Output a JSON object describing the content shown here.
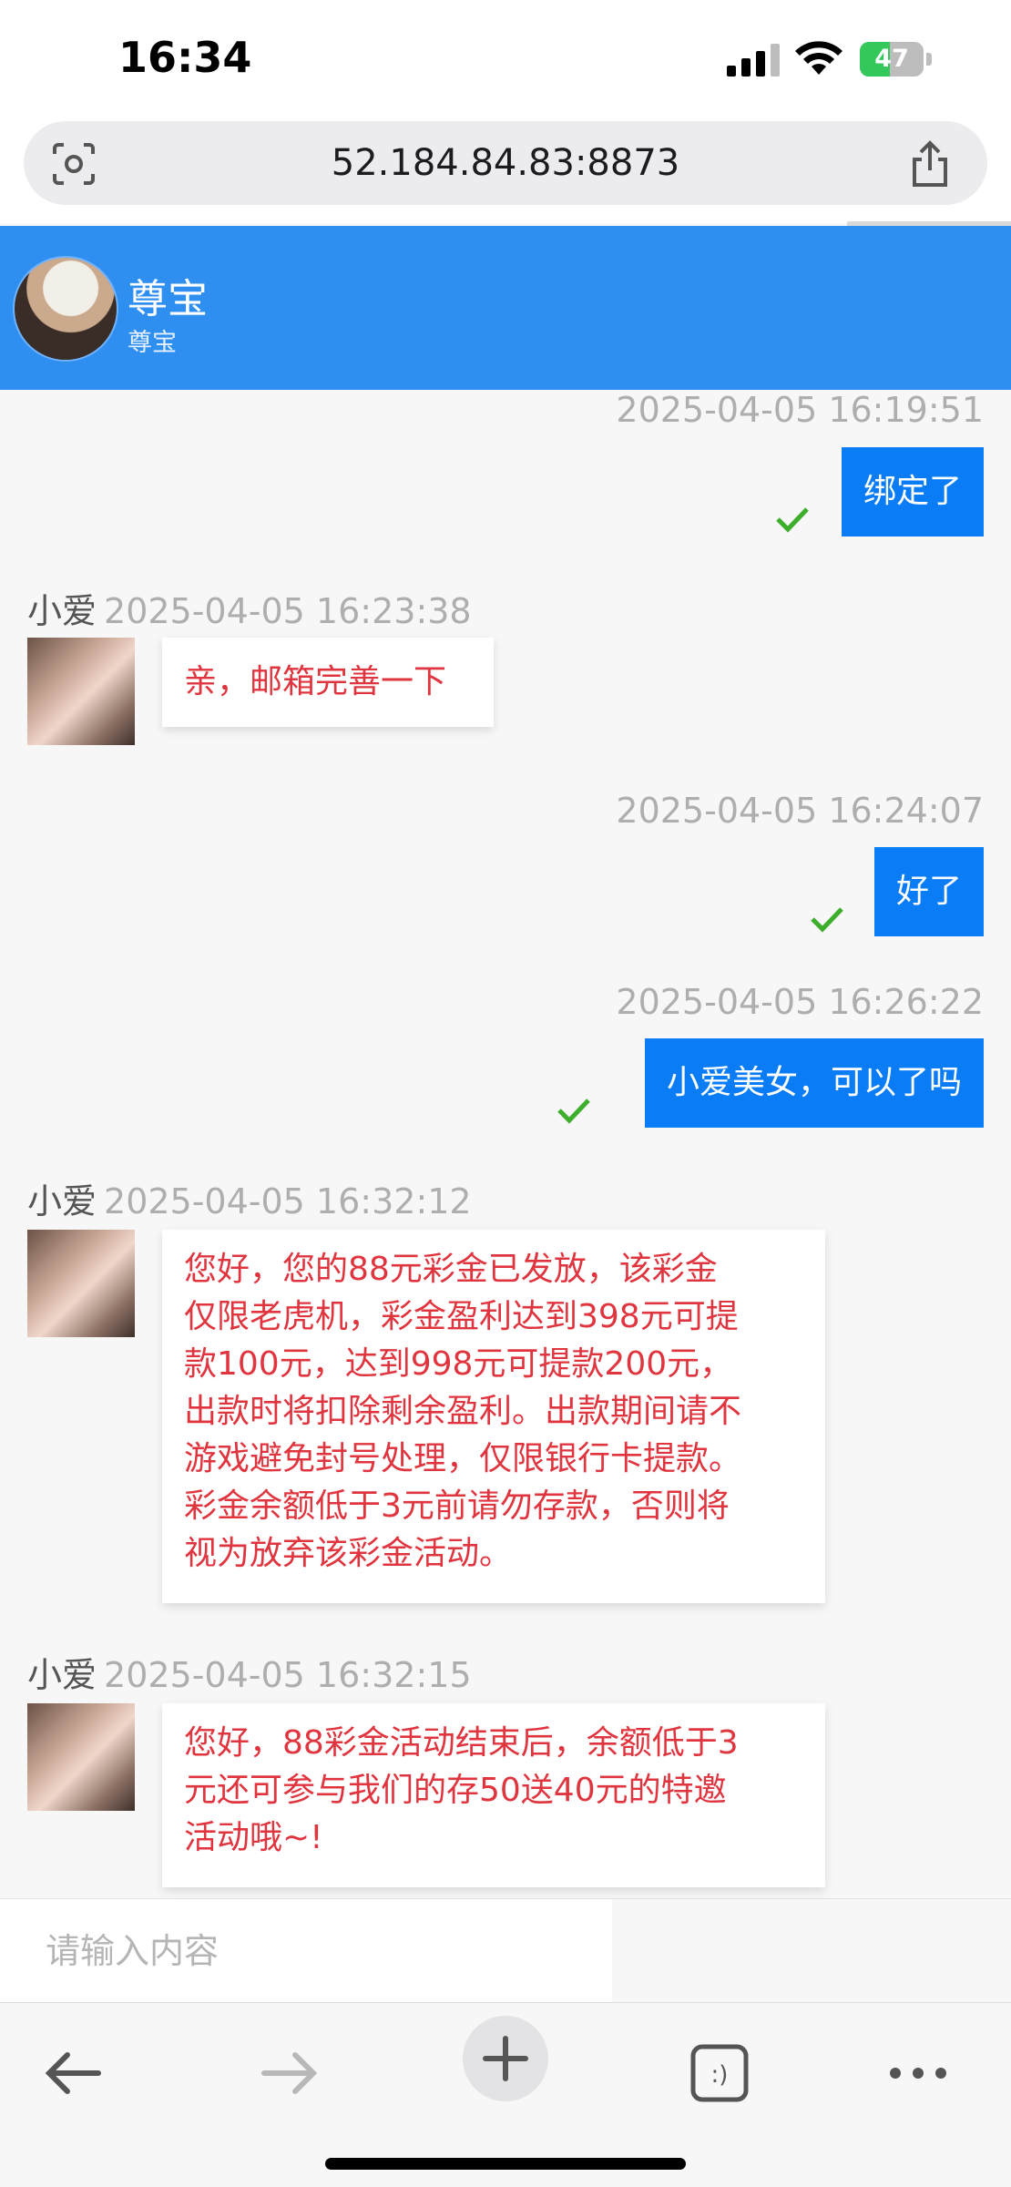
{
  "status_bar": {
    "time": "16:34",
    "battery": "47",
    "battery_level": 0.47
  },
  "browser": {
    "url": "52.184.84.83:8873",
    "load_progress": 0.84
  },
  "chat": {
    "title": "尊宝",
    "subtitle": "尊宝"
  },
  "messages": [
    {
      "direction": "out",
      "timestamp": "2025-04-05 16:19:51",
      "text": "绑定了"
    },
    {
      "direction": "in",
      "sender": "小爱",
      "timestamp": "2025-04-05 16:23:38",
      "text": "亲，邮箱完善一下"
    },
    {
      "direction": "out",
      "timestamp": "2025-04-05 16:24:07",
      "text": "好了"
    },
    {
      "direction": "out",
      "timestamp": "2025-04-05 16:26:22",
      "text": "小爱美女，可以了吗"
    },
    {
      "direction": "in",
      "sender": "小爱",
      "timestamp": "2025-04-05 16:32:12",
      "lines": [
        "您好，您的88元彩金已发放，该彩金",
        "仅限老虎机，彩金盈利达到398元可提",
        "款100元，达到998元可提款200元，",
        "出款时将扣除剩余盈利。出款期间请不",
        "游戏避免封号处理，仅限银行卡提款。",
        "彩金余额低于3元前请勿存款，否则将",
        "视为放弃该彩金活动。"
      ]
    },
    {
      "direction": "in",
      "sender": "小爱",
      "timestamp": "2025-04-05 16:32:15",
      "lines": [
        "您好，88彩金活动结束后，余额低于3",
        "元还可参与我们的存50送40元的特邀",
        "活动哦~!"
      ]
    }
  ],
  "input": {
    "placeholder": "请输入内容"
  },
  "toolbar": [
    "back-icon",
    "forward-icon",
    "new-tab-icon",
    "tabs-icon",
    "more-icon"
  ],
  "colors": {
    "header": "#2f8ff0",
    "outgoing": "#0a7cf5",
    "incoming_text": "#e0353f",
    "check": "#3dae2b"
  }
}
